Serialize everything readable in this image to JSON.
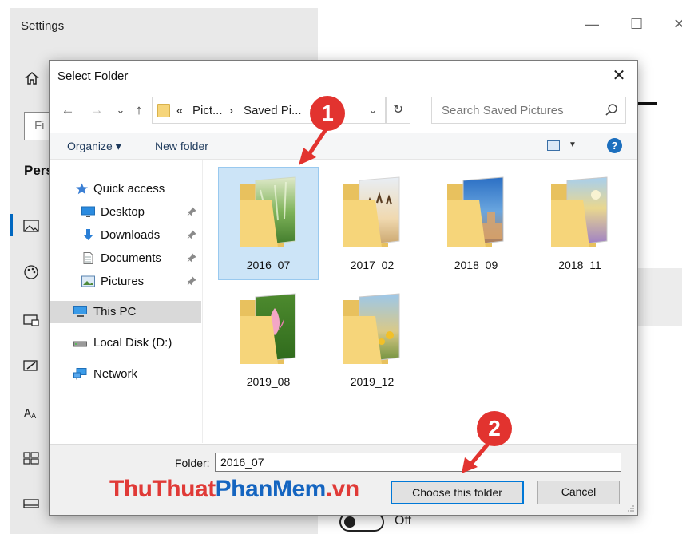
{
  "background_window": {
    "title": "Settings",
    "search_placeholder_partial": "Fi",
    "section_partial": "Pers",
    "minimize_glyph": "—",
    "maximize_glyph": "☐",
    "close_glyph": "✕",
    "toggle_label": "Off",
    "nav_icons": [
      "home-icon",
      "picture-icon",
      "palette-icon",
      "lock-screen-icon",
      "theme-icon",
      "font-icon",
      "start-icon",
      "taskbar-icon"
    ]
  },
  "dialog": {
    "title": "Select Folder",
    "close_glyph": "✕",
    "nav": {
      "back": "←",
      "forward": "→",
      "recent": "⌄",
      "up": "↑"
    },
    "address": {
      "sep1": "«",
      "part1": "Pict...",
      "arrow": "›",
      "part2": "Saved Pi...",
      "arrow2": "›",
      "dropdown": "⌄",
      "refresh": "↻"
    },
    "search_placeholder": "Search Saved Pictures",
    "commands": {
      "organize": "Organize ▾",
      "new_folder": "New folder",
      "help": "?"
    },
    "nav_pane": [
      {
        "label": "Quick access",
        "icon": "star-icon",
        "pinned": false
      },
      {
        "label": "Desktop",
        "icon": "desktop-icon",
        "pinned": true
      },
      {
        "label": "Downloads",
        "icon": "download-icon",
        "pinned": true
      },
      {
        "label": "Documents",
        "icon": "document-icon",
        "pinned": true
      },
      {
        "label": "Pictures",
        "icon": "pictures-icon",
        "pinned": true
      },
      {
        "label": "This PC",
        "icon": "computer-icon",
        "selected": true
      },
      {
        "label": "Local Disk (D:)",
        "icon": "drive-icon"
      },
      {
        "label": "Network",
        "icon": "network-icon"
      }
    ],
    "folders": [
      {
        "name": "2016_07",
        "selected": true,
        "theme": "forest"
      },
      {
        "name": "2017_02",
        "theme": "people"
      },
      {
        "name": "2018_09",
        "theme": "city"
      },
      {
        "name": "2018_11",
        "theme": "flowers"
      },
      {
        "name": "2019_08",
        "theme": "lotus"
      },
      {
        "name": "2019_12",
        "theme": "sunflower"
      }
    ],
    "footer": {
      "folder_label": "Folder:",
      "folder_value": "2016_07",
      "choose_button": "Choose this folder",
      "cancel_button": "Cancel"
    }
  },
  "annotations": {
    "step1": "1",
    "step2": "2"
  },
  "watermark": {
    "part1": "ThuThuat",
    "part2": "PhanMem",
    "part3": ".vn"
  },
  "colors": {
    "accent": "#0067c0",
    "badge": "#e2332f",
    "selection": "#cce4f7",
    "folder": "#f6d57a"
  }
}
